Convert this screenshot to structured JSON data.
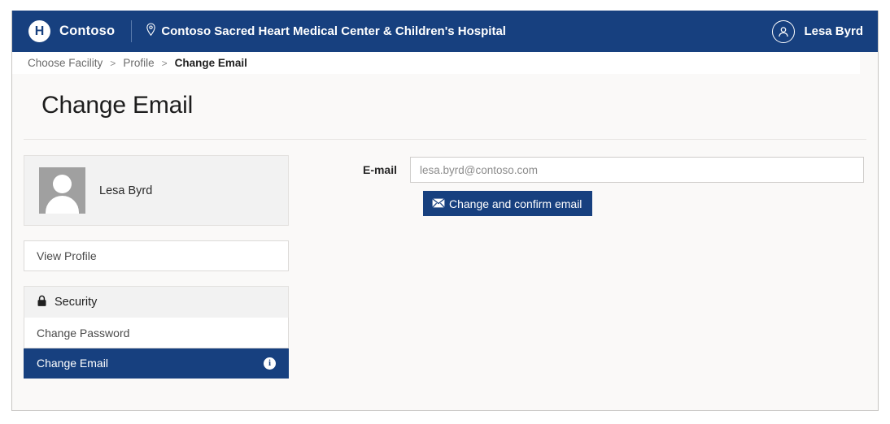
{
  "colors": {
    "brand_navy": "#17407f",
    "page_bg": "#faf9f8",
    "panel_gray": "#f2f2f2",
    "border_gray": "#dcdad8"
  },
  "topbar": {
    "logo_letter": "H",
    "logo_icon": "hospital-circle-icon",
    "brand_name": "Contoso",
    "facility_icon": "location-pin-icon",
    "facility_name": "Contoso Sacred Heart Medical Center & Children's Hospital",
    "user_icon": "user-avatar-icon",
    "user_name": "Lesa Byrd"
  },
  "breadcrumb": {
    "items": [
      {
        "label": "Choose Facility",
        "current": false
      },
      {
        "label": "Profile",
        "current": false
      },
      {
        "label": "Change Email",
        "current": true
      }
    ],
    "separator": ">"
  },
  "page": {
    "title": "Change Email"
  },
  "sidebar": {
    "profile_card": {
      "avatar_icon": "user-placeholder-avatar",
      "name": "Lesa Byrd"
    },
    "view_profile_label": "View Profile",
    "security_group": {
      "icon": "lock-icon",
      "header": "Security",
      "items": [
        {
          "label": "Change Password",
          "active": false,
          "icon": ""
        },
        {
          "label": "Change Email",
          "active": true,
          "icon": "info-circle-icon",
          "icon_glyph": "i"
        }
      ]
    }
  },
  "form": {
    "email_label": "E-mail",
    "email_value": "lesa.byrd@contoso.com",
    "email_placeholder": "lesa.byrd@contoso.com",
    "submit_icon": "envelope-icon",
    "submit_label": "Change and confirm email"
  }
}
